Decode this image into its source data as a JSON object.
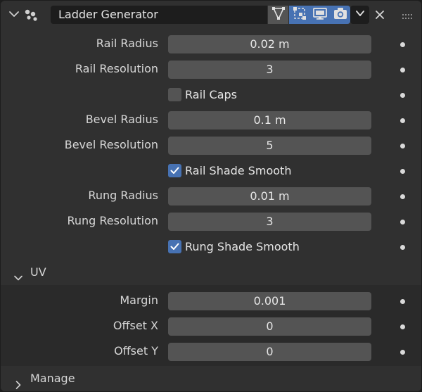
{
  "modifier": {
    "name": "Ladder Generator",
    "visibility_buttons": [
      "edit-mode-icon",
      "cage-icon",
      "viewport-icon",
      "render-icon"
    ]
  },
  "fields": [
    {
      "label": "Rail Radius",
      "value": "0.02 m"
    },
    {
      "label": "Rail Resolution",
      "value": "3"
    },
    {
      "label": "Bevel Radius",
      "value": "0.1 m"
    },
    {
      "label": "Bevel Resolution",
      "value": "5"
    },
    {
      "label": "Rung Radius",
      "value": "0.01 m"
    },
    {
      "label": "Rung Resolution",
      "value": "3"
    }
  ],
  "checkboxes": [
    {
      "label": "Rail Caps",
      "checked": false
    },
    {
      "label": "Rail Shade Smooth",
      "checked": true
    },
    {
      "label": "Rung Shade Smooth",
      "checked": true
    }
  ],
  "uv": {
    "title": "UV",
    "expanded": true,
    "fields": [
      {
        "label": "Margin",
        "value": "0.001"
      },
      {
        "label": "Offset X",
        "value": "0"
      },
      {
        "label": "Offset Y",
        "value": "0"
      }
    ]
  },
  "manage": {
    "title": "Manage",
    "expanded": false
  },
  "colors": {
    "accent": "#4772b3",
    "panel": "#303030",
    "field": "#545454",
    "subpanel": "#2a2a2a"
  }
}
